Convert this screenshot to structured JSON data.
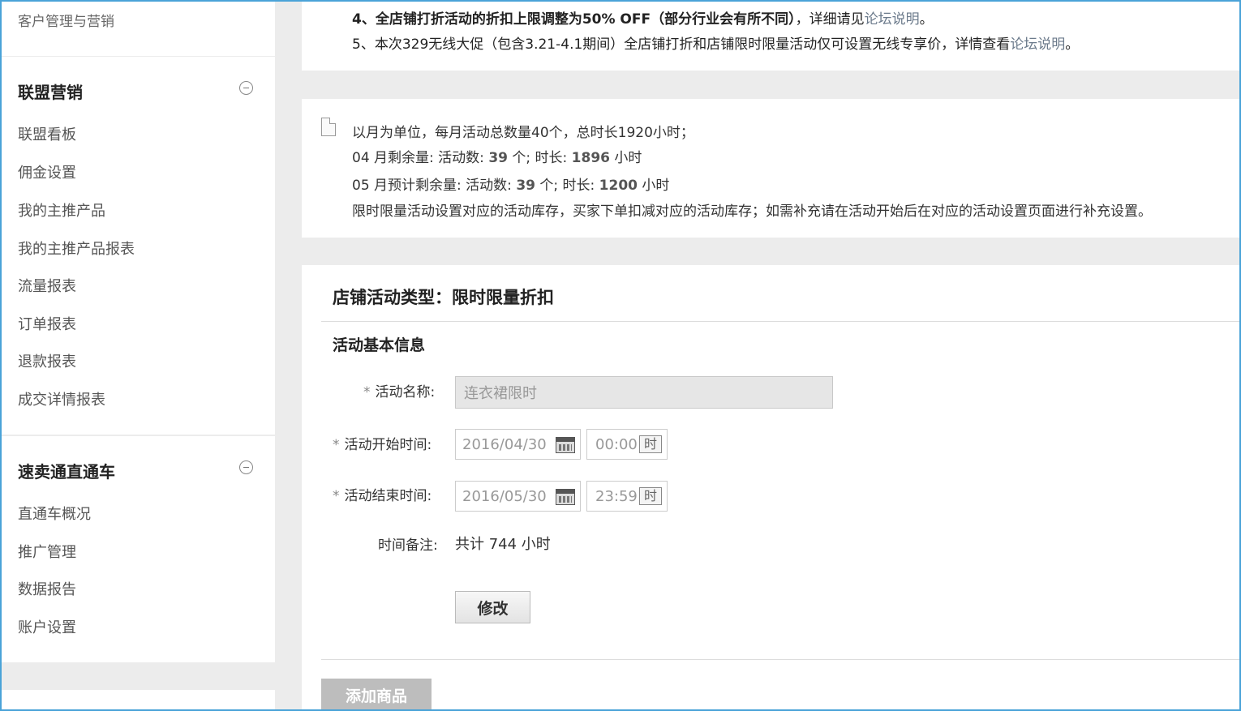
{
  "sidebar": {
    "top_item": "客户管理与营销",
    "groups": [
      {
        "title": "联盟营销",
        "items": [
          "联盟看板",
          "佣金设置",
          "我的主推产品",
          "我的主推产品报表",
          "流量报表",
          "订单报表",
          "退款报表",
          "成交详情报表"
        ]
      },
      {
        "title": "速卖通直通车",
        "items": [
          "直通车概况",
          "推广管理",
          "数据报告",
          "账户设置"
        ]
      }
    ]
  },
  "notices": {
    "line4_bold": "4、全店铺打折活动的折扣上限调整为50% OFF（部分行业会有所不同）",
    "line4_text": "，详细请见",
    "line4_link": "论坛说明",
    "line4_end": "。",
    "line5_text": "5、本次329无线大促（包含3.21-4.1期间）全店铺打折和店铺限时限量活动仅可设置无线专享价，详情查看",
    "line5_link": "论坛说明",
    "line5_end": "。"
  },
  "quota": {
    "intro": "以月为单位，每月活动总数量40个，总时长1920小时；",
    "apr_prefix": "04 月剩余量: 活动数: ",
    "apr_count": "39",
    "apr_mid": " 个; 时长: ",
    "apr_hours": "1896",
    "apr_suffix": " 小时",
    "may_prefix": "05 月预计剩余量: 活动数: ",
    "may_count": "39",
    "may_mid": " 个; 时长: ",
    "may_hours": "1200",
    "may_suffix": " 小时",
    "note": "限时限量活动设置对应的活动库存，买家下单扣减对应的活动库存；如需补充请在活动开始后在对应的活动设置页面进行补充设置。"
  },
  "form": {
    "title": "店铺活动类型：限时限量折扣",
    "section": "活动基本信息",
    "required_mark": "*",
    "name_label": "活动名称:",
    "name_value": "连衣裙限时",
    "start_label": "活动开始时间:",
    "start_date": "2016/04/30",
    "start_time": "00:00",
    "end_label": "活动结束时间:",
    "end_date": "2016/05/30",
    "end_time": "23:59",
    "time_icon_text": "时",
    "duration_label": "时间备注:",
    "duration_value": "共计 744 小时",
    "modify_button": "修改",
    "add_product_button": "添加商品"
  }
}
